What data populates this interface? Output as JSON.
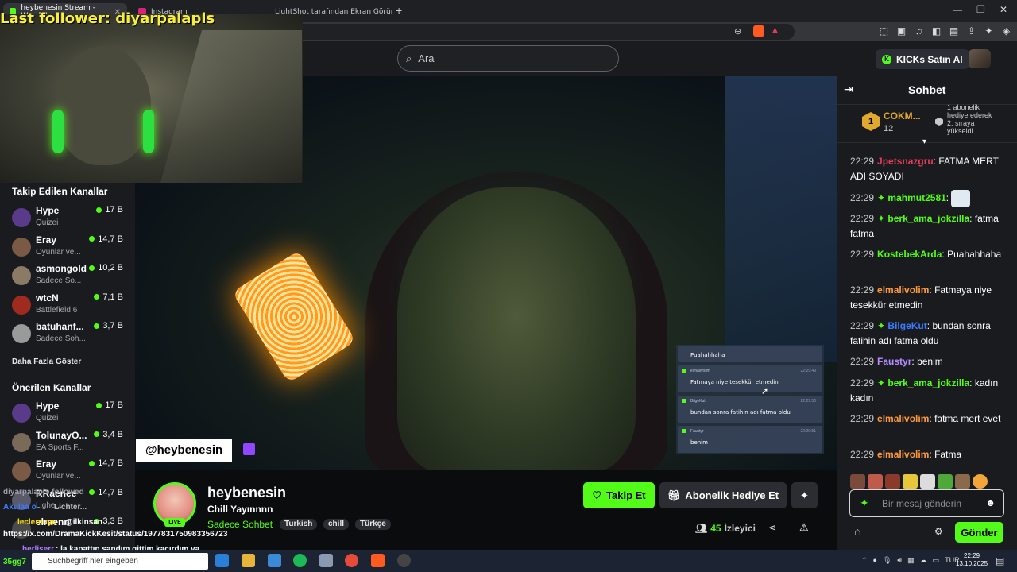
{
  "browser": {
    "tabs": [
      {
        "label": "heybenesin Stream - Watch L"
      },
      {
        "label": "Instagram"
      },
      {
        "label": "LightShot tarafından Ekran Görüntüsü"
      }
    ],
    "new_tab": "+",
    "window_controls": {
      "minimize": "—",
      "maximize": "❐",
      "close": "✕"
    }
  },
  "overlay": {
    "last_follower": "Last follower: diyarpalapls",
    "handle": "@heybenesin",
    "bottom_lines": [
      {
        "text": "diyarpalapls followed",
        "color": "#9aa0a6"
      },
      {
        "text": "Akulaa o",
        "color": "#3b7bff"
      },
      {
        "text": "Lichter...",
        "color": "#bdbdbd"
      },
      {
        "text": "leclercuyu",
        "color": "#ffd700"
      },
      {
        "text": "@ilkinsan",
        "color": "#ffffff"
      },
      {
        "text": "https://x.com/DramaKickKesit/status/1977831750983356723",
        "color": "#ffffff"
      },
      {
        "text": "berliserr",
        "color": "#a97bff"
      },
      {
        "text": ": la kapattın sandım gittim kaçırdım ya",
        "color": "#ffffff"
      }
    ]
  },
  "header": {
    "search_placeholder": "Ara",
    "kicks_button": "KICKs Satın Al"
  },
  "sidebar": {
    "followed_title": "Takip Edilen Kanallar",
    "followed": [
      {
        "name": "Hype",
        "sub": "Quizei",
        "viewers": "17 B",
        "color": "#5a3a8a"
      },
      {
        "name": "Eray",
        "sub": "Oyunlar ve...",
        "viewers": "14,7 B",
        "color": "#7a5a44"
      },
      {
        "name": "asmongold",
        "sub": "Sadece So...",
        "viewers": "10,2 B",
        "color": "#8a7a66"
      },
      {
        "name": "wtcN",
        "sub": "Battlefield 6",
        "viewers": "7,1 B",
        "color": "#a02a1e"
      },
      {
        "name": "batuhanf...",
        "sub": "Sadece Soh...",
        "viewers": "3,7 B",
        "color": "#9a9a9a"
      }
    ],
    "more": "Daha Fazla Göster",
    "recommended_title": "Önerilen Kanallar",
    "recommended": [
      {
        "name": "Hype",
        "sub": "Quizei",
        "viewers": "17 B",
        "color": "#5a3a8a"
      },
      {
        "name": "TolunayO...",
        "sub": "EA Sports F...",
        "viewers": "3,4 B",
        "color": "#7a6a5a"
      },
      {
        "name": "Eray",
        "sub": "Oyunlar ve...",
        "viewers": "14,7 B",
        "color": "#7a5a44"
      },
      {
        "name": "RRaenee",
        "sub": "Lighe...",
        "viewers": "14,7 B",
        "color": "#5a5a6a"
      },
      {
        "name": "elraenn",
        "sub": "",
        "viewers": "3,3 B",
        "color": "#4a4a4a"
      }
    ]
  },
  "stream": {
    "channel": "heybenesin",
    "title": "Chill Yayınnnn",
    "category": "Sadece Sohbet",
    "tags": [
      "Turkish",
      "chill",
      "Türkçe"
    ],
    "live": "LIVE",
    "follow": "Takip Et",
    "gift_sub": "Abonelik Hediye Et",
    "viewers": "45",
    "viewers_label": "İzleyici",
    "overlay_chat": [
      {
        "user": "",
        "text": "Puahahhaha",
        "time": ""
      },
      {
        "user": "elmalivolim",
        "text": "Fatmaya niye tesekkür etmedin",
        "time": "22:29:49"
      },
      {
        "user": "BilgeKut",
        "text": "bundan sonra fatihin adı fatma oldu",
        "time": "22:29:50"
      },
      {
        "user": "Faustyr",
        "text": "benim",
        "time": "22:29:51"
      }
    ]
  },
  "chat": {
    "title": "Sohbet",
    "pinned": {
      "rank": "1",
      "user": "COKM...",
      "count": "12",
      "note": "1 abonelik hediye ederek 2. sıraya yükseldi"
    },
    "messages": [
      {
        "time": "22:29",
        "user": "Jpetsnazgru",
        "color": "#e83b5a",
        "badge": false,
        "text": "FATMA MERT ADI SOYADI"
      },
      {
        "time": "22:29",
        "user": "mahmut2581",
        "color": "#53fc18",
        "badge": true,
        "text": ""
      },
      {
        "time": "22:29",
        "user": "berk_ama_jokzilla",
        "color": "#53fc18",
        "badge": true,
        "text": "fatma fatma"
      },
      {
        "time": "22:29",
        "user": "KostebekArda",
        "color": "#53fc18",
        "badge": false,
        "text": "Puahahhaha"
      },
      {
        "time": "22:29",
        "user": "elmalivolim",
        "color": "#ff9a3c",
        "badge": false,
        "text": "Fatmaya niye tesekkür etmedin"
      },
      {
        "time": "22:29",
        "user": "BilgeKut",
        "color": "#3b7bff",
        "badge": true,
        "text": "bundan sonra fatihin adı fatma oldu"
      },
      {
        "time": "22:29",
        "user": "Faustyr",
        "color": "#b48cff",
        "badge": false,
        "text": "benim"
      },
      {
        "time": "22:29",
        "user": "berk_ama_jokzilla",
        "color": "#53fc18",
        "badge": true,
        "text": "kadın kadın"
      },
      {
        "time": "22:29",
        "user": "elmalivolim",
        "color": "#ff9a3c",
        "badge": false,
        "text": "fatma mert evet"
      },
      {
        "time": "22:29",
        "user": "elmalivolim",
        "color": "#ff9a3c",
        "badge": false,
        "text": "Fatma"
      }
    ],
    "input_placeholder": "Bir mesaj gönderin",
    "send": "Gönder"
  },
  "taskbar": {
    "search_placeholder": "Suchbegriff hier eingeben",
    "lang": "TUR",
    "time": "22:29",
    "date": "13.10.2025",
    "left_value": "35gg7"
  },
  "colors": {
    "accent": "#53fc18",
    "bg": "#191b1f"
  }
}
